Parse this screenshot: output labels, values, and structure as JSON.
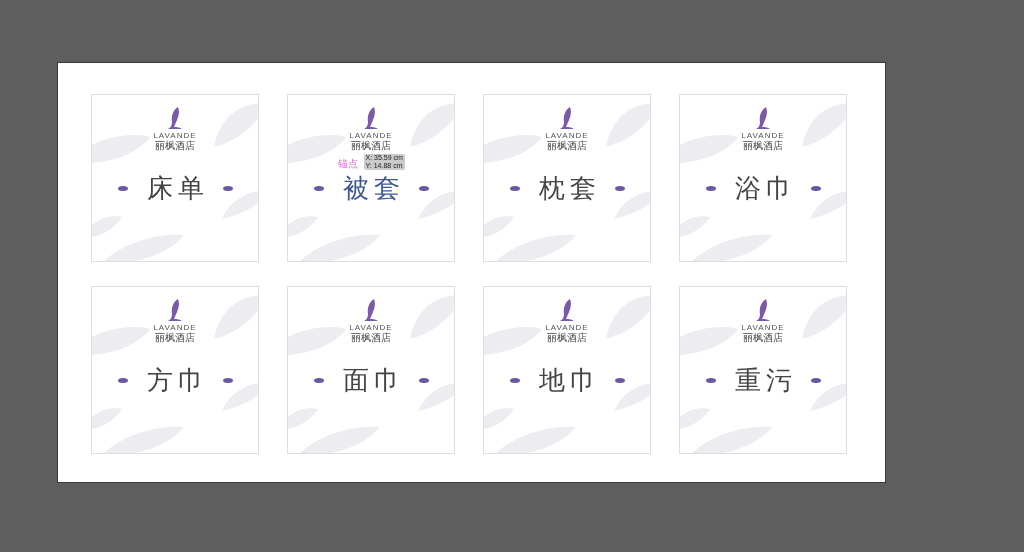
{
  "artboard": {
    "cards": [
      {
        "brand": "LAVANDE",
        "brand_cn": "丽枫酒店",
        "title": "床单",
        "selected": false
      },
      {
        "brand": "LAVANDE",
        "brand_cn": "丽枫酒店",
        "title": "被套",
        "selected": true
      },
      {
        "brand": "LAVANDE",
        "brand_cn": "丽枫酒店",
        "title": "枕套",
        "selected": false
      },
      {
        "brand": "LAVANDE",
        "brand_cn": "丽枫酒店",
        "title": "浴巾",
        "selected": false
      },
      {
        "brand": "LAVANDE",
        "brand_cn": "丽枫酒店",
        "title": "方巾",
        "selected": false
      },
      {
        "brand": "LAVANDE",
        "brand_cn": "丽枫酒店",
        "title": "面巾",
        "selected": false
      },
      {
        "brand": "LAVANDE",
        "brand_cn": "丽枫酒店",
        "title": "地巾",
        "selected": false
      },
      {
        "brand": "LAVANDE",
        "brand_cn": "丽枫酒店",
        "title": "重污",
        "selected": false
      }
    ]
  },
  "cursor_tooltip": {
    "anchor_label": "锚点",
    "x": "X: 35.59 cm",
    "y": "Y: 14.88 cm"
  }
}
